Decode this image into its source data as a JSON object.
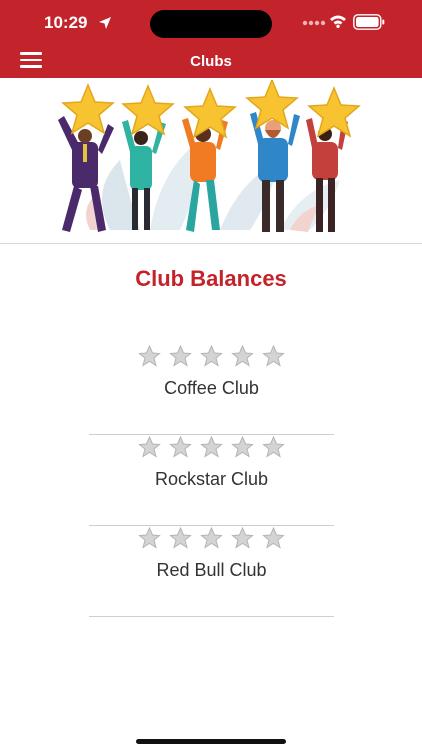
{
  "status_bar": {
    "time": "10:29",
    "icons": [
      "location-arrow-icon",
      "signal-icon",
      "wifi-icon",
      "battery-icon"
    ]
  },
  "header": {
    "title": "Clubs",
    "menu_icon": "hamburger-menu-icon",
    "background_color": "#c3232a"
  },
  "hero": {
    "description_icon": "people-holding-stars-illustration"
  },
  "main": {
    "section_title": "Club Balances",
    "accent_color": "#c3232a",
    "clubs": [
      {
        "name": "Coffee Club",
        "stars_filled": 0,
        "stars_total": 5
      },
      {
        "name": "Rockstar Club",
        "stars_filled": 0,
        "stars_total": 5
      },
      {
        "name": "Red Bull Club",
        "stars_filled": 0,
        "stars_total": 5
      }
    ]
  }
}
